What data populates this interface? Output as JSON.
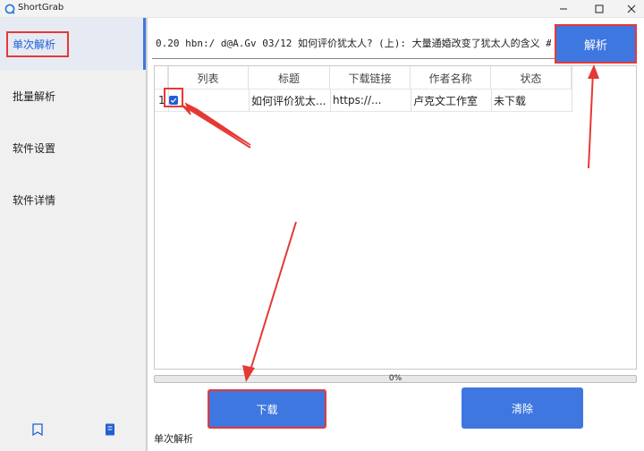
{
  "window": {
    "title": "ShortGrab"
  },
  "sidebar": {
    "items": [
      {
        "label": "单次解析"
      },
      {
        "label": "批量解析"
      },
      {
        "label": "软件设置"
      },
      {
        "label": "软件详情"
      }
    ]
  },
  "input": {
    "value": "0.20 hbn:/ d@A.Gv 03/12 如何评价犹太人? (上): 大量通婚改变了犹太人的含义 # 犹太人"
  },
  "parse_button": "解析",
  "table": {
    "headers": [
      "列表",
      "标题",
      "下载链接",
      "作者名称",
      "状态"
    ],
    "rows": [
      {
        "index": "1",
        "checked": true,
        "title": "如何评价犹太...",
        "link": "https://...",
        "author": "卢克文工作室",
        "status": "未下载"
      }
    ]
  },
  "progress": {
    "value": 0,
    "label": "0%"
  },
  "buttons": {
    "download": "下载",
    "clear": "清除"
  },
  "status_text": "单次解析",
  "colors": {
    "accent": "#3f77e0",
    "annotation": "#e53935"
  }
}
